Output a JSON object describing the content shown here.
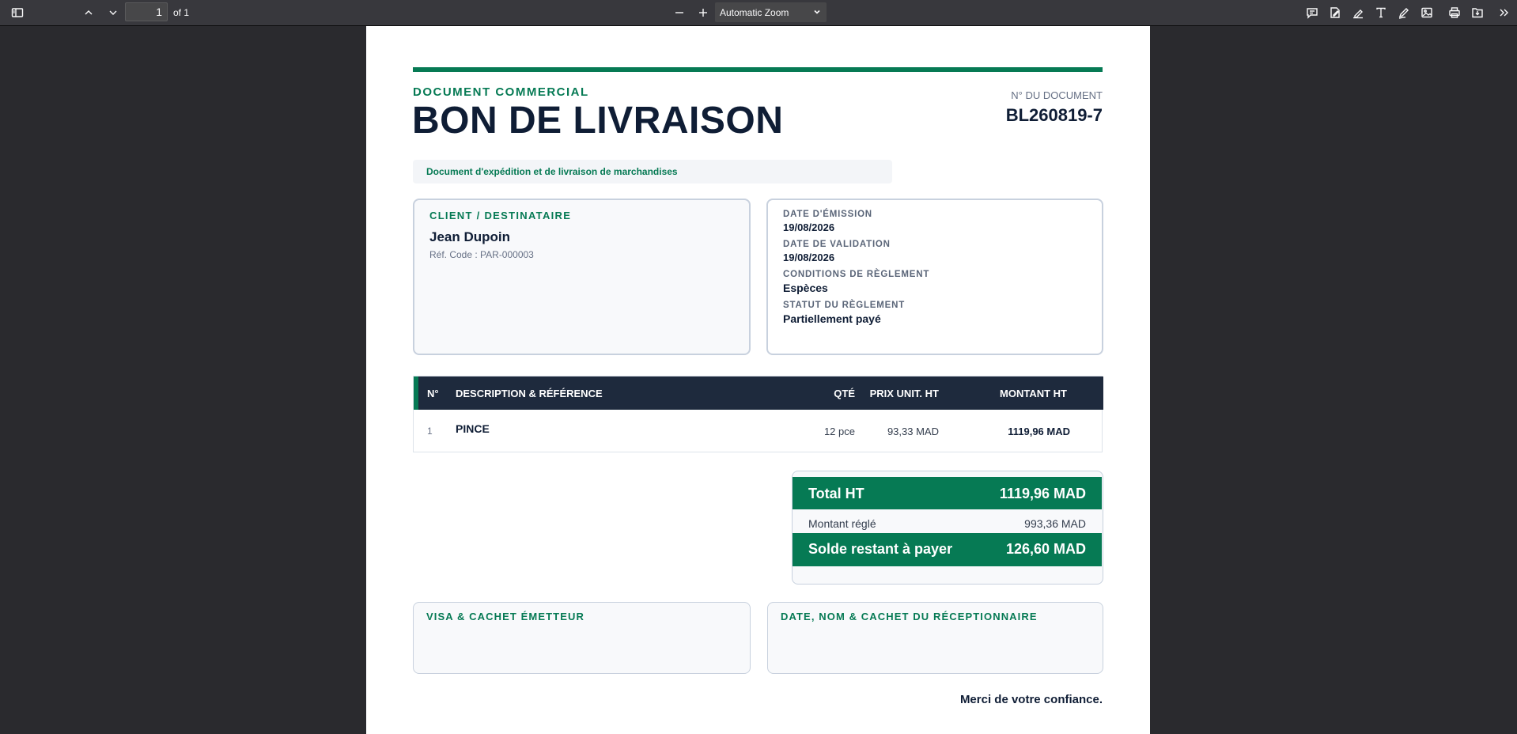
{
  "viewer": {
    "page_number": "1",
    "page_count": "of 1",
    "zoom": "Automatic Zoom"
  },
  "document": {
    "kicker": "DOCUMENT COMMERCIAL",
    "title": "BON DE LIVRAISON",
    "doc_number_label": "N° DU DOCUMENT",
    "doc_number": "BL260819-7",
    "subtitle": "Document d'expédition et de livraison de marchandises",
    "client": {
      "section_title": "CLIENT / DESTINATAIRE",
      "name": "Jean Dupoin",
      "ref": "Réf. Code : PAR-000003"
    },
    "meta": [
      {
        "label": "DATE D'ÉMISSION",
        "value": "19/08/2026"
      },
      {
        "label": "DATE DE VALIDATION",
        "value": "19/08/2026"
      },
      {
        "label": "CONDITIONS DE RÈGLEMENT",
        "value": "Espèces"
      },
      {
        "label": "STATUT DU RÈGLEMENT",
        "value": "Partiellement payé"
      }
    ],
    "table": {
      "headers": {
        "no": "N°",
        "desc": "DESCRIPTION & RÉFÉRENCE",
        "qty": "QTÉ",
        "unit": "PRIX UNIT. HT",
        "amount": "MONTANT HT"
      },
      "rows": [
        {
          "no": "1",
          "desc": "PINCE",
          "qty": "12 pce",
          "unit": "93,33 MAD",
          "amount": "1119,96 MAD"
        }
      ]
    },
    "totals": {
      "total_ht_label": "Total HT",
      "total_ht": "1119,96 MAD",
      "paid_label": "Montant réglé",
      "paid": "993,36 MAD",
      "balance_label": "Solde restant à payer",
      "balance": "126,60 MAD"
    },
    "signatures": {
      "issuer": "VISA & CACHET ÉMETTEUR",
      "receiver": "DATE, NOM & CACHET DU RÉCEPTIONNAIRE"
    },
    "thanks": "Merci de votre confiance."
  },
  "colors": {
    "accent": "#067a54",
    "dark": "#1e2a3d",
    "toolbar": "#38383d"
  },
  "icons": [
    "sidebar-toggle-icon",
    "chevron-up-icon",
    "chevron-down-icon",
    "zoom-out-icon",
    "zoom-in-icon",
    "comment-icon",
    "signature-icon",
    "highlight-icon",
    "text-icon",
    "draw-icon",
    "image-icon",
    "print-icon",
    "save-icon",
    "double-chevron-right-icon"
  ]
}
